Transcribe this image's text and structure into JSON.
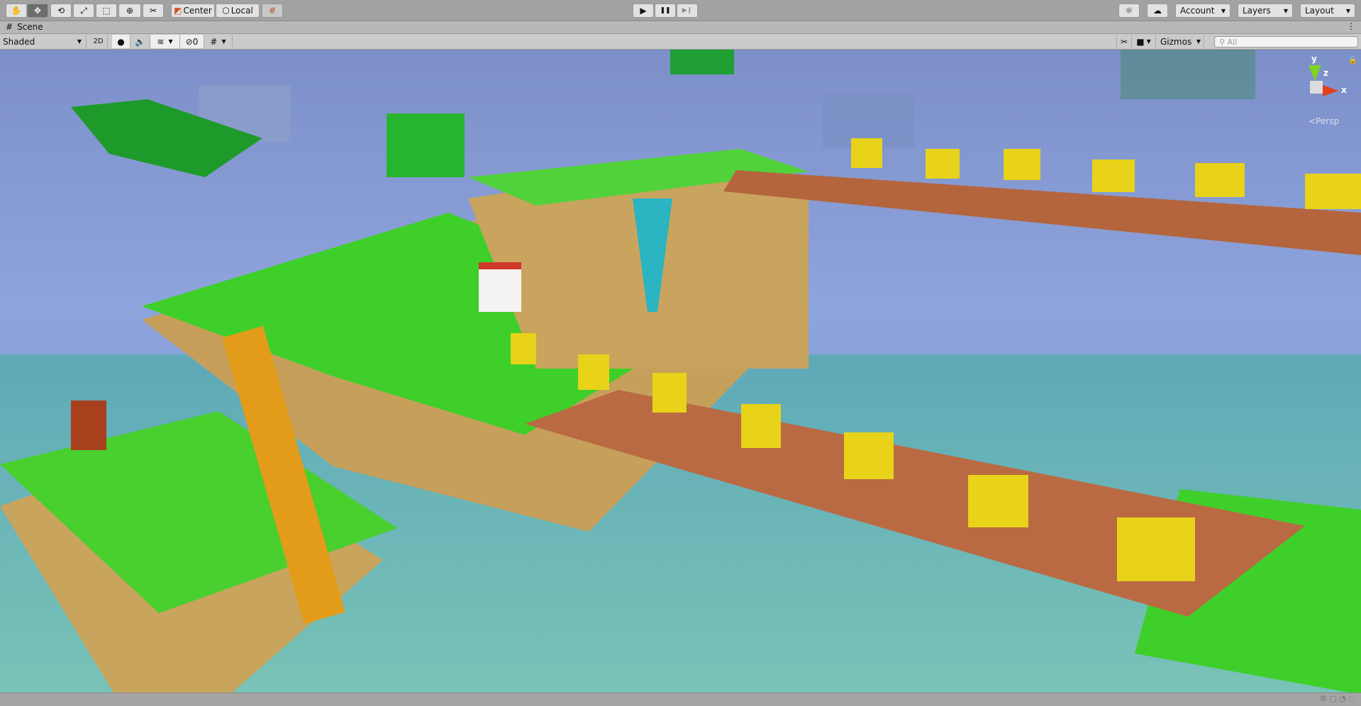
{
  "toolbar": {
    "tools": [
      {
        "name": "hand-tool",
        "glyph": "✋"
      },
      {
        "name": "move-tool",
        "glyph": "✥"
      },
      {
        "name": "rotate-tool",
        "glyph": "⟲"
      },
      {
        "name": "scale-tool",
        "glyph": "⤢"
      },
      {
        "name": "rect-tool",
        "glyph": "⬚"
      },
      {
        "name": "transform-tool",
        "glyph": "⊕"
      },
      {
        "name": "custom-tool",
        "glyph": "✂"
      }
    ],
    "active_tool": "move-tool",
    "pivot_label": "Center",
    "space_label": "Local",
    "play_icons": {
      "play": "▶",
      "pause": "❚❚",
      "step": "▶❙"
    },
    "account_label": "Account",
    "layers_label": "Layers",
    "layout_label": "Layout"
  },
  "scene_tab": {
    "title": "Scene"
  },
  "scene_toolbar": {
    "draw_mode": "Shaded",
    "mode_2d": "2D",
    "hidden_count": "0",
    "gizmos_label": "Gizmos",
    "search_placeholder": "All"
  },
  "gizmo": {
    "x": "x",
    "y": "y",
    "z": "z",
    "projection": "Persp"
  },
  "colors": {
    "sky": "#7c8fc9",
    "grass": "#3fd12a",
    "dirt": "#c9a25a",
    "wood": "#b2603a",
    "water": "#6fb8b4",
    "coin": "#e8d21a"
  }
}
